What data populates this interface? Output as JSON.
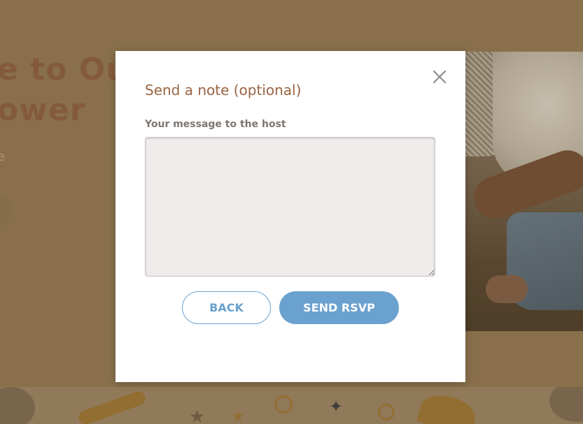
{
  "background": {
    "hero_line1": "e to Our",
    "hero_line2": "ower",
    "hero_sub": "e"
  },
  "modal": {
    "title": "Send a note (optional)",
    "field_label": "Your message to the host",
    "message_value": "",
    "close_icon": "close-icon",
    "back_label": "BACK",
    "send_label": "SEND RSVP"
  },
  "colors": {
    "accent_blue": "#6aa1cf",
    "title_brown": "#9a6444",
    "label_gray": "#7d7670"
  }
}
